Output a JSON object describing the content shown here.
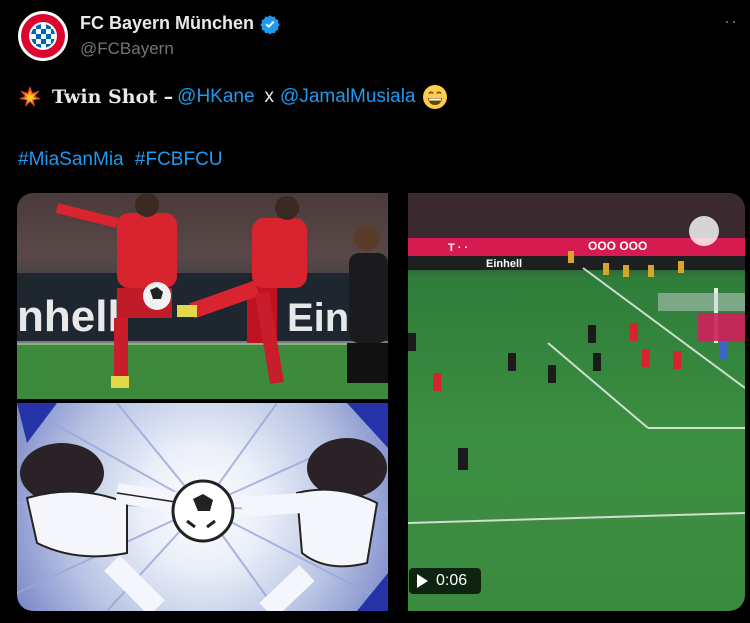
{
  "account": {
    "display_name": "FC Bayern München",
    "handle": "@FCBayern",
    "avatar_icon": "fc-bayern-logo-icon",
    "verified_icon": "verified-badge-icon",
    "more_label": "··"
  },
  "tweet": {
    "emoji_icon": "collision-emoji-icon",
    "bold_text": "Twin Shot –",
    "mention1": "@HKane",
    "separator": "x",
    "mention2": "@JamalMusiala",
    "end_emoji_icon": "grinning-face-emoji-icon",
    "hashtags": [
      "#MiaSanMia",
      "#FCBFCU"
    ]
  },
  "media": {
    "video_duration": "0:06",
    "play_icon": "play-icon"
  },
  "colors": {
    "background": "#000000",
    "text": "#e7e9ea",
    "secondary": "#71767b",
    "link": "#1d9bf0",
    "verified": "#1d9bf0"
  }
}
